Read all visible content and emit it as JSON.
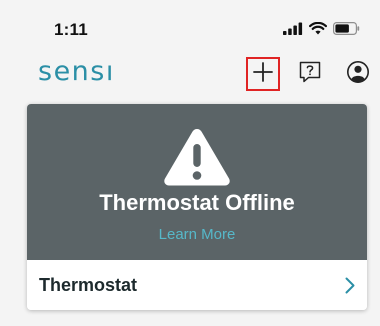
{
  "status_bar": {
    "time": "1:11",
    "icons": [
      "signal-icon",
      "wifi-icon",
      "battery-icon"
    ]
  },
  "header": {
    "logo_text": "sensı",
    "buttons": [
      "add-icon",
      "help-icon",
      "account-icon"
    ]
  },
  "colors": {
    "brand": "#2b8fa6",
    "banner": "#5b6467",
    "link": "#56b8c9",
    "highlight": "#e02424"
  },
  "card": {
    "status_title": "Thermostat Offline",
    "learn_more": "Learn More",
    "row_label": "Thermostat"
  }
}
